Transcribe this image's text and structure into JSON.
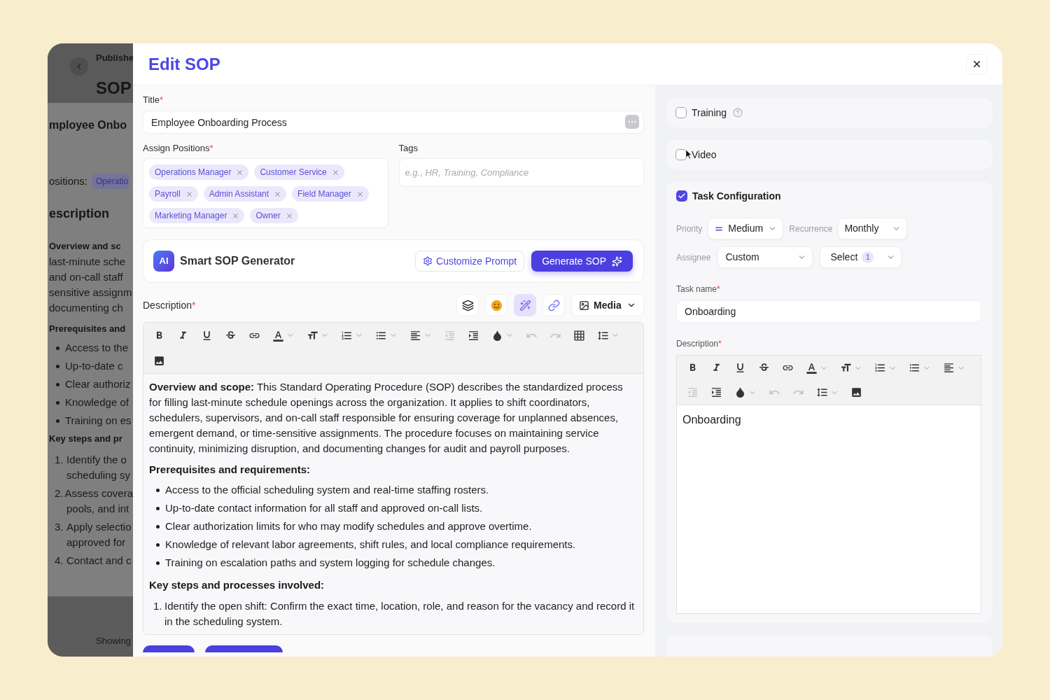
{
  "background_page": {
    "breadcrumb": "Publishe",
    "heading": "SOP",
    "record_title": "mployee Onbo",
    "positions_label": "ositions:",
    "position_tag": "Operatio",
    "section_title": "escription",
    "blocks": [
      {
        "kind": "bold",
        "text": "Overview and sc"
      },
      {
        "kind": "plain",
        "text": "last-minute sche"
      },
      {
        "kind": "plain",
        "text": "and on-call staff"
      },
      {
        "kind": "plain",
        "text": "sensitive assignm"
      },
      {
        "kind": "plain",
        "text": "documenting ch"
      },
      {
        "kind": "bold",
        "text": "Prerequisites and"
      },
      {
        "kind": "bullet",
        "text": "Access to the"
      },
      {
        "kind": "bullet",
        "text": "Up-to-date c"
      },
      {
        "kind": "bullet",
        "text": "Clear authoriz"
      },
      {
        "kind": "bullet",
        "text": "Knowledge of"
      },
      {
        "kind": "bullet",
        "text": "Training on es"
      },
      {
        "kind": "bold",
        "text": "Key steps and pr"
      },
      {
        "kind": "numbered",
        "marker": "1.",
        "text": "Identify the o"
      },
      {
        "kind": "continued",
        "text": "scheduling sy"
      },
      {
        "kind": "numbered",
        "marker": "2.",
        "text": "Assess covera"
      },
      {
        "kind": "continued",
        "text": "pools, and int"
      },
      {
        "kind": "numbered",
        "marker": "3.",
        "text": "Apply selectio"
      },
      {
        "kind": "continued",
        "text": "approved for"
      },
      {
        "kind": "numbered",
        "marker": "4.",
        "text": "Contact and c"
      }
    ],
    "footer": "Showing"
  },
  "dialog": {
    "title": "Edit SOP"
  },
  "form": {
    "title": {
      "label": "Title",
      "mark": "*",
      "value": "Employee Onboarding Process"
    },
    "positions": {
      "label": "Assign Positions",
      "mark": "*",
      "tags": [
        "Operations Manager",
        "Customer Service",
        "Payroll",
        "Admin Assistant",
        "Field Manager",
        "Marketing Manager",
        "Owner"
      ]
    },
    "tags": {
      "label": "Tags",
      "placeholder": "e.g., HR, Training, Compliance"
    },
    "generator": {
      "badge": "AI",
      "title": "Smart SOP Generator",
      "buttons": [
        {
          "kind": "outline",
          "label": "Customize Prompt"
        },
        {
          "kind": "primary",
          "label": "Generate SOP"
        }
      ]
    },
    "description": {
      "label": "Description",
      "mark": "*",
      "tools": [
        {
          "kind": "layers",
          "selected": false
        },
        {
          "kind": "emoji",
          "selected": false
        },
        {
          "kind": "wand",
          "selected": true
        },
        {
          "kind": "link",
          "selected": false
        }
      ],
      "media": "Media",
      "toolbar": [
        [
          {
            "kind": "bold",
            "dropdown": false,
            "disabled": false
          },
          {
            "kind": "italic",
            "dropdown": false,
            "disabled": false
          },
          {
            "kind": "underline",
            "dropdown": false,
            "disabled": false
          },
          {
            "kind": "strikethrough",
            "dropdown": false,
            "disabled": false
          },
          {
            "kind": "link",
            "dropdown": false,
            "disabled": false
          },
          {
            "kind": "font_color",
            "dropdown": true,
            "disabled": false
          },
          {
            "kind": "font_size",
            "dropdown": true,
            "disabled": false
          },
          {
            "kind": "ordered_list",
            "dropdown": true,
            "disabled": false
          },
          {
            "kind": "bullet_list",
            "dropdown": true,
            "disabled": false
          },
          {
            "kind": "align",
            "dropdown": true,
            "disabled": false
          },
          {
            "kind": "outdent",
            "dropdown": false,
            "disabled": true
          },
          {
            "kind": "indent",
            "dropdown": false,
            "disabled": false
          },
          {
            "kind": "fill_color",
            "dropdown": true,
            "disabled": false
          },
          {
            "kind": "undo",
            "dropdown": false,
            "disabled": true
          },
          {
            "kind": "redo",
            "dropdown": false,
            "disabled": true
          },
          {
            "kind": "table",
            "dropdown": false,
            "disabled": false
          },
          {
            "kind": "line_height",
            "dropdown": true,
            "disabled": false
          }
        ],
        [
          {
            "kind": "image",
            "dropdown": false,
            "disabled": false
          }
        ]
      ],
      "content": [
        {
          "kind": "paragraph",
          "text": "**Overview and scope:** This Standard Operating Procedure (SOP) describes the standardized process for filling last-minute schedule openings across the organization. It applies to shift coordinators, schedulers, supervisors, and on-call staff responsible for ensuring coverage for unplanned absences, emergent demand, or time-sensitive assignments. The procedure focuses on maintaining service continuity, minimizing disruption, and documenting changes for audit and payroll purposes."
        },
        {
          "kind": "heading",
          "text": "Prerequisites and requirements:"
        },
        {
          "kind": "bullets",
          "items": [
            "Access to the official scheduling system and real-time staffing rosters.",
            "Up-to-date contact information for all staff and approved on-call lists.",
            "Clear authorization limits for who may modify schedules and approve overtime.",
            "Knowledge of relevant labor agreements, shift rules, and local compliance requirements.",
            "Training on escalation paths and system logging for schedule changes."
          ]
        },
        {
          "kind": "heading",
          "text": "Key steps and processes involved:"
        },
        {
          "kind": "numbered",
          "items": [
            {
              "marker": "1.",
              "text": "Identify the open shift: Confirm the exact time, location, role, and reason for the vacancy and record it in the scheduling system."
            }
          ]
        }
      ]
    }
  },
  "settings": {
    "options": [
      {
        "label": "Training",
        "checked": false,
        "help": true
      },
      {
        "label": "Video",
        "checked": false,
        "help": false
      }
    ],
    "task": {
      "label": "Task Configuration",
      "checked": true,
      "priority": {
        "label": "Priority",
        "value": "Medium"
      },
      "recurrence": {
        "label": "Recurrence",
        "value": "Monthly"
      },
      "assignee": {
        "label": "Assignee",
        "value": "Custom"
      },
      "assignee_select": {
        "value": "Select",
        "count": "1"
      },
      "task_name": {
        "label": "Task name",
        "mark": "*",
        "value": "Onboarding"
      },
      "description": {
        "label": "Description",
        "mark": "*",
        "toolbar": [
          [
            {
              "kind": "bold",
              "dropdown": false,
              "disabled": false
            },
            {
              "kind": "italic",
              "dropdown": false,
              "disabled": false
            },
            {
              "kind": "underline",
              "dropdown": false,
              "disabled": false
            },
            {
              "kind": "strikethrough",
              "dropdown": false,
              "disabled": false
            },
            {
              "kind": "link",
              "dropdown": false,
              "disabled": false
            },
            {
              "kind": "font_color",
              "dropdown": true,
              "disabled": false
            },
            {
              "kind": "font_size",
              "dropdown": true,
              "disabled": false
            },
            {
              "kind": "ordered_list",
              "dropdown": true,
              "disabled": false
            },
            {
              "kind": "bullet_list",
              "dropdown": true,
              "disabled": false
            },
            {
              "kind": "align",
              "dropdown": true,
              "disabled": false
            }
          ],
          [
            {
              "kind": "outdent",
              "dropdown": false,
              "disabled": true
            },
            {
              "kind": "indent",
              "dropdown": false,
              "disabled": false
            },
            {
              "kind": "fill_color",
              "dropdown": true,
              "disabled": false
            },
            {
              "kind": "undo",
              "dropdown": false,
              "disabled": true
            },
            {
              "kind": "redo",
              "dropdown": false,
              "disabled": true
            },
            {
              "kind": "line_height",
              "dropdown": true,
              "disabled": false
            },
            {
              "kind": "image",
              "dropdown": false,
              "disabled": false
            }
          ]
        ],
        "content": "Onboarding"
      }
    }
  }
}
